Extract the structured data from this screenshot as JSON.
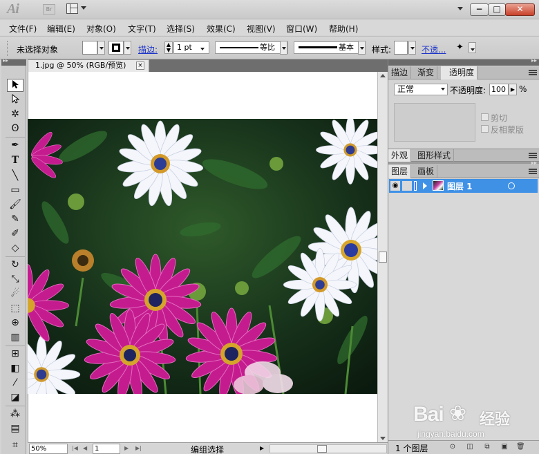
{
  "app": {
    "logo": "Ai",
    "bridge_badge": "Br"
  },
  "menu": [
    "文件(F)",
    "编辑(E)",
    "对象(O)",
    "文字(T)",
    "选择(S)",
    "效果(C)",
    "视图(V)",
    "窗口(W)",
    "帮助(H)"
  ],
  "control": {
    "selection_status": "未选择对象",
    "stroke_link": "描边:",
    "stroke_weight": "1 pt",
    "profile_label": "等比",
    "brush_label": "基本",
    "style_label": "样式:",
    "opacity_link": "不透..."
  },
  "document": {
    "tab_title": "1.jpg @ 50% (RGB/预览)",
    "tab_close": "×"
  },
  "status": {
    "zoom": "50%",
    "page": "1",
    "status_text": "编组选择"
  },
  "panels": {
    "top_tabs": [
      "描边",
      "渐变",
      "透明度"
    ],
    "blend_mode": "正常",
    "opacity_label": "不透明度:",
    "opacity_value": "100",
    "opacity_unit": "%",
    "clip_label": "剪切",
    "invert_mask_label": "反相蒙版",
    "mid_tabs": [
      "外观",
      "图形样式"
    ],
    "layer_tabs": [
      "图层",
      "画板"
    ],
    "layer_name": "图层 1",
    "layer_count": "1 个图层"
  },
  "watermark": {
    "logo": "Bai",
    "suffix": "经验",
    "url": "jingyan.baidu.com"
  },
  "colors": {
    "layer_highlight": "#3f91e6",
    "link": "#1f36c8",
    "close_button": "#c8412b"
  }
}
